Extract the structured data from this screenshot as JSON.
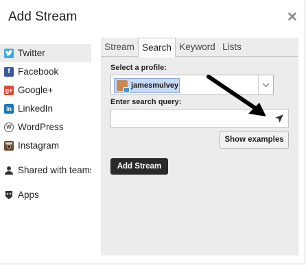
{
  "dialog": {
    "title": "Add Stream",
    "close_icon": "close-icon"
  },
  "sidebar": {
    "items": [
      {
        "label": "Twitter",
        "icon": "twitter-icon",
        "color": "#3fa9e0",
        "active": true
      },
      {
        "label": "Facebook",
        "icon": "facebook-icon",
        "color": "#3b5998"
      },
      {
        "label": "Google+",
        "icon": "google-plus-icon",
        "color": "#dd4b39"
      },
      {
        "label": "LinkedIn",
        "icon": "linkedin-icon",
        "color": "#1a77b5"
      },
      {
        "label": "WordPress",
        "icon": "wordpress-icon",
        "color": "#555555"
      },
      {
        "label": "Instagram",
        "icon": "instagram-icon",
        "color": "#6b4a33"
      },
      {
        "label": "Shared with teams",
        "icon": "team-icon",
        "color": "#333333"
      },
      {
        "label": "Apps",
        "icon": "apps-icon",
        "color": "#333333"
      }
    ]
  },
  "tabs": [
    {
      "label": "Stream"
    },
    {
      "label": "Search",
      "active": true
    },
    {
      "label": "Keyword"
    },
    {
      "label": "Lists"
    }
  ],
  "search": {
    "profile_label": "Select a profile:",
    "profile_value": "jamesmulvey",
    "query_label": "Enter search query:",
    "query_value": "",
    "show_examples_label": "Show examples",
    "add_stream_label": "Add Stream"
  },
  "colors": {
    "panel_bg": "#ececec",
    "chip_bg": "#c9daf5",
    "dark_button": "#2a2a2a"
  }
}
